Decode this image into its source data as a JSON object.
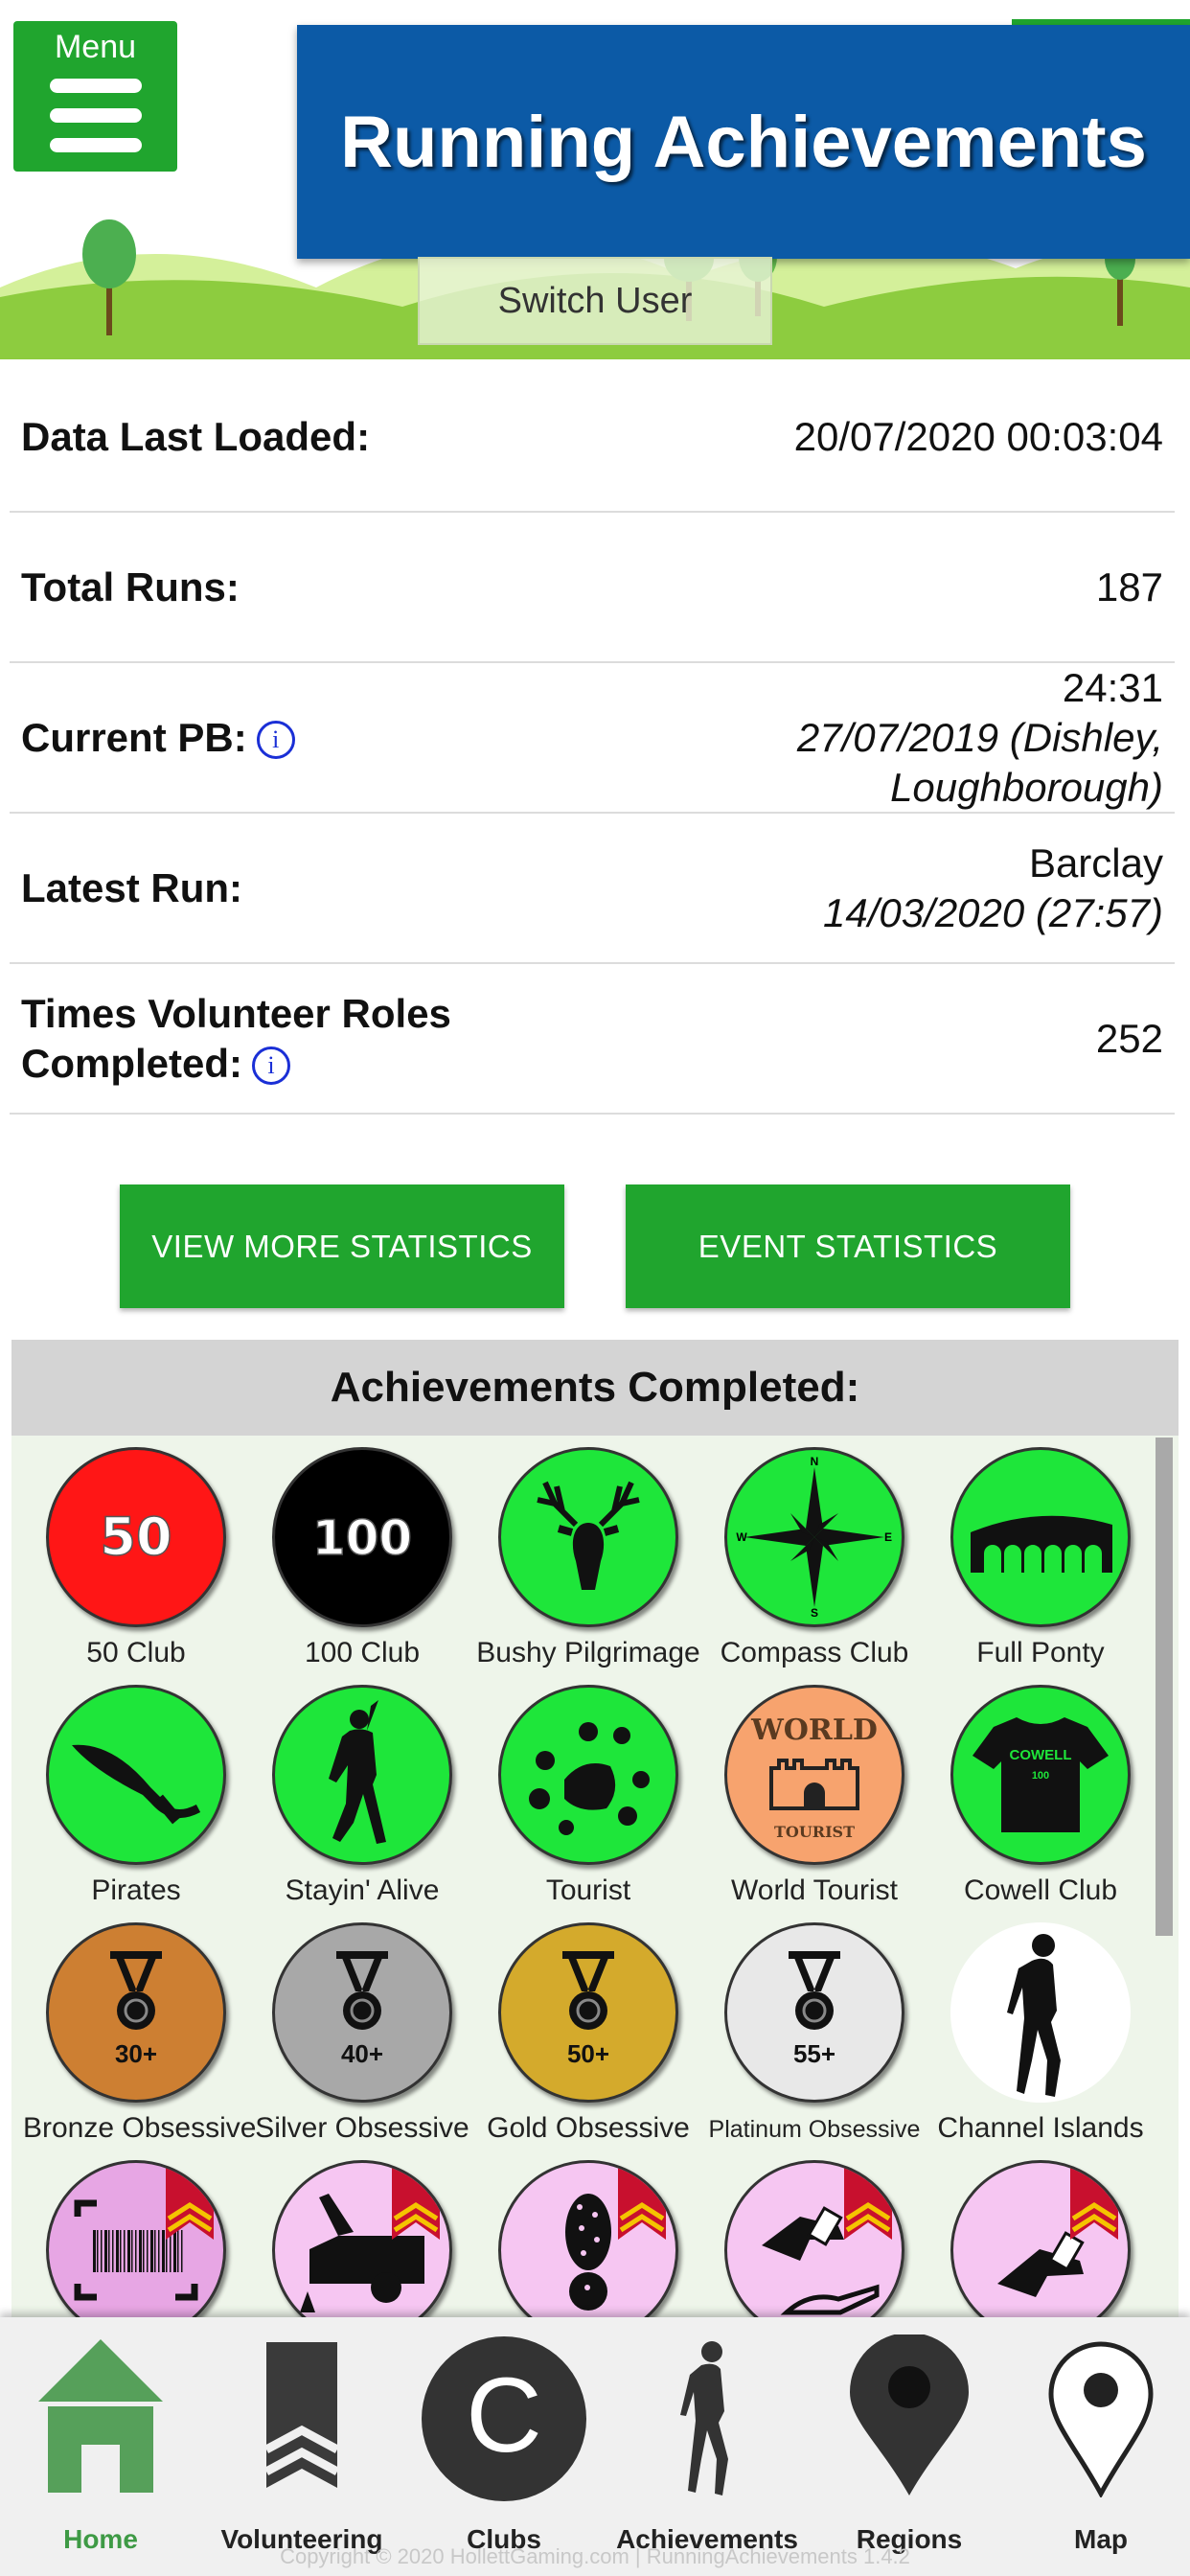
{
  "header": {
    "menu_label": "Menu",
    "title": "Running Achievements",
    "switch_user": "Switch User"
  },
  "stats": {
    "last_loaded_label": "Data Last Loaded:",
    "last_loaded_value": "20/07/2020 00:03:04",
    "total_runs_label": "Total Runs:",
    "total_runs_value": "187",
    "pb_label": "Current PB:",
    "pb_time": "24:31",
    "pb_detail_1": "27/07/2019  (Dishley,",
    "pb_detail_2": "Loughborough)",
    "latest_label": "Latest Run:",
    "latest_event": "Barclay",
    "latest_detail": "14/03/2020  (27:57)",
    "volunteer_label_1": "Times Volunteer Roles",
    "volunteer_label_2": "Completed:",
    "volunteer_value": "252",
    "info_glyph": "i"
  },
  "buttons": {
    "more_stats": "VIEW MORE STATISTICS",
    "event_stats": "EVENT STATISTICS"
  },
  "achievements": {
    "heading": "Achievements Completed:",
    "items": [
      {
        "name": "50 Club",
        "color": "#ff1616",
        "icon": "50-icon",
        "text": "50"
      },
      {
        "name": "100 Club",
        "color": "#000000",
        "icon": "100-icon",
        "text": "100"
      },
      {
        "name": "Bushy Pilgrimage",
        "color": "#1ee63a",
        "icon": "stag-icon"
      },
      {
        "name": "Compass Club",
        "color": "#1ee63a",
        "icon": "compass-icon",
        "compass": [
          "N",
          "E",
          "S",
          "W"
        ]
      },
      {
        "name": "Full Ponty",
        "color": "#1ee63a",
        "icon": "viaduct-icon"
      },
      {
        "name": "Pirates",
        "color": "#1ee63a",
        "icon": "cutlass-icon"
      },
      {
        "name": "Stayin' Alive",
        "color": "#1ee63a",
        "icon": "dancer-icon"
      },
      {
        "name": "Tourist",
        "color": "#1ee63a",
        "icon": "cow-spots-icon"
      },
      {
        "name": "World Tourist",
        "color": "#f7a36e",
        "icon": "castle-icon",
        "top_text": "WORLD",
        "bottom_text": "TOURIST"
      },
      {
        "name": "Cowell Club",
        "color": "#1ee63a",
        "icon": "tshirt-icon",
        "shirt_top": "COWELL",
        "shirt_num": "100"
      },
      {
        "name": "Bronze Obsessive",
        "color": "#cd7f32",
        "icon": "medal-icon",
        "text": "30+"
      },
      {
        "name": "Silver Obsessive",
        "color": "#a8a8a8",
        "icon": "medal-icon",
        "text": "40+"
      },
      {
        "name": "Gold Obsessive",
        "color": "#d4aa2c",
        "icon": "medal-icon",
        "text": "50+"
      },
      {
        "name": "Platinum Obsessive",
        "color": "#e8e8e8",
        "icon": "medal-icon",
        "text": "55+"
      },
      {
        "name": "Channel Islands",
        "color": "#ffffff",
        "icon": "runner-icon"
      },
      {
        "name": "",
        "color": "#e7a6e4",
        "icon": "barcode-scanner-icon"
      },
      {
        "name": "",
        "color": "#f6c6f2",
        "icon": "car-boot-icon"
      },
      {
        "name": "",
        "color": "#f6c6f2",
        "icon": "footprint-icon"
      },
      {
        "name": "",
        "color": "#f6c6f2",
        "icon": "handing-token-icon"
      },
      {
        "name": "",
        "color": "#f6c6f2",
        "icon": "hand-token-icon"
      }
    ]
  },
  "nav": {
    "items": [
      {
        "label": "Home",
        "icon": "home-icon",
        "active": true
      },
      {
        "label": "Volunteering",
        "icon": "chevron-bookmark-icon",
        "active": false
      },
      {
        "label": "Clubs",
        "icon": "clubs-c-icon",
        "glyph": "C",
        "active": false
      },
      {
        "label": "Achievements",
        "icon": "runner-icon",
        "active": false
      },
      {
        "label": "Regions",
        "icon": "map-pin-filled-icon",
        "active": false
      },
      {
        "label": "Map",
        "icon": "map-pin-outline-icon",
        "active": false
      }
    ]
  },
  "footer": {
    "copyright": "Copyright © 2020 HollettGaming.com | RunningAchievements 1.4.2"
  },
  "colors": {
    "accent_green": "#20a52e",
    "title_blue": "#0c5aa6",
    "info_blue": "#1a2fd6",
    "active_nav": "#3e9a45"
  }
}
